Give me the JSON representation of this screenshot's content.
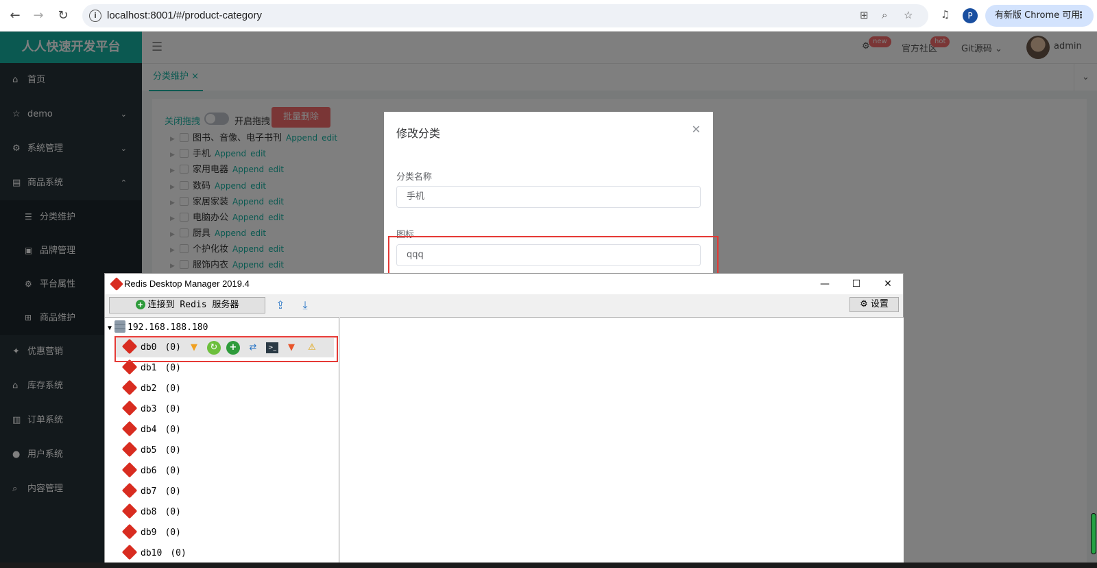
{
  "browser": {
    "url": "localhost:8001/#/product-category",
    "profile_letter": "P",
    "update_label": "有新版 Chrome 可用"
  },
  "sidebar": {
    "brand": "人人快速开发平台",
    "items": [
      {
        "label": "首页"
      },
      {
        "label": "demo"
      },
      {
        "label": "系统管理"
      },
      {
        "label": "商品系统"
      },
      {
        "label": "优惠营销"
      },
      {
        "label": "库存系统"
      },
      {
        "label": "订单系统"
      },
      {
        "label": "用户系统"
      },
      {
        "label": "内容管理"
      }
    ],
    "sub_items": [
      {
        "label": "分类维护"
      },
      {
        "label": "品牌管理"
      },
      {
        "label": "平台属性"
      },
      {
        "label": "商品维护"
      }
    ]
  },
  "topnav": {
    "settings_badge": "new",
    "community": "官方社区",
    "community_badge": "hot",
    "git": "Git源码",
    "user": "admin"
  },
  "tabs": {
    "active": "分类维护"
  },
  "category_page": {
    "drag_off": "关闭拖拽",
    "drag_on": "开启拖拽",
    "batch_delete": "批量删除",
    "append_label": "Append",
    "edit_label": "edit",
    "nodes": [
      {
        "label": "图书、音像、电子书刊"
      },
      {
        "label": "手机"
      },
      {
        "label": "家用电器"
      },
      {
        "label": "数码"
      },
      {
        "label": "家居家装"
      },
      {
        "label": "电脑办公"
      },
      {
        "label": "厨具"
      },
      {
        "label": "个护化妆"
      },
      {
        "label": "服饰内衣"
      }
    ]
  },
  "dialog": {
    "title": "修改分类",
    "name_label": "分类名称",
    "name_value": "手机",
    "icon_label": "图标",
    "icon_value": "qqq"
  },
  "rdm": {
    "title": "Redis Desktop Manager 2019.4",
    "connect_label": "连接到 Redis 服务器",
    "settings_label": "设置",
    "server": "192.168.188.180",
    "databases": [
      {
        "name": "db0",
        "count": "(0)"
      },
      {
        "name": "db1",
        "count": "(0)"
      },
      {
        "name": "db2",
        "count": "(0)"
      },
      {
        "name": "db3",
        "count": "(0)"
      },
      {
        "name": "db4",
        "count": "(0)"
      },
      {
        "name": "db5",
        "count": "(0)"
      },
      {
        "name": "db6",
        "count": "(0)"
      },
      {
        "name": "db7",
        "count": "(0)"
      },
      {
        "name": "db8",
        "count": "(0)"
      },
      {
        "name": "db9",
        "count": "(0)"
      },
      {
        "name": "db10",
        "count": "(0)"
      }
    ]
  },
  "colors": {
    "brand": "#17b3a3",
    "sidebar": "#263238",
    "danger": "#f56c6c",
    "highlight_box": "#e53935",
    "redis_red": "#d82c20"
  }
}
